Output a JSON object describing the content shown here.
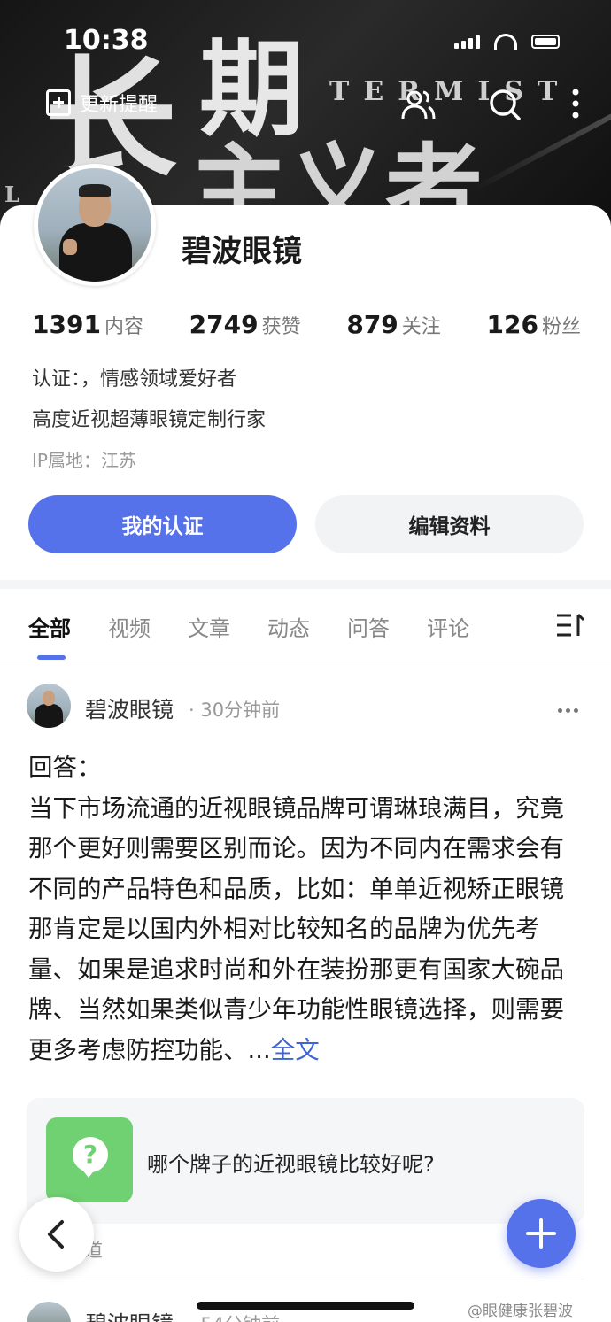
{
  "status_bar": {
    "time": "10:38"
  },
  "banner": {
    "chars": [
      "长",
      "期",
      "主义者"
    ],
    "english": "TERMIST",
    "english_left": "L"
  },
  "top_bar": {
    "update_label": "更新提醒",
    "icons": [
      "users-icon",
      "search-icon",
      "more-icon"
    ]
  },
  "profile": {
    "name": "碧波眼镜",
    "stats": [
      {
        "num": "1391",
        "label": "内容"
      },
      {
        "num": "2749",
        "label": "获赞"
      },
      {
        "num": "879",
        "label": "关注"
      },
      {
        "num": "126",
        "label": "粉丝"
      }
    ],
    "bio_line1": "认证：，情感领域爱好者",
    "bio_line2": "高度近视超薄眼镜定制行家",
    "ip": "IP属地：江苏",
    "btn_primary": "我的认证",
    "btn_secondary": "编辑资料"
  },
  "tabs": {
    "items": [
      "全部",
      "视频",
      "文章",
      "动态",
      "问答",
      "评论"
    ],
    "active": 0,
    "menu_glyph": "三|"
  },
  "post": {
    "author": "碧波眼镜",
    "time": "· 30分钟前",
    "body": "回答：\n当下市场流通的近视眼镜品牌可谓琳琅满目，究竟那个更好则需要区别而论。因为不同内在需求会有不同的产品特色和品质，比如：单单近视矫正眼镜那肯定是以国内外相对比较知名的品牌为优先考量、如果是追求时尚和外在装扮那更有国家大碗品牌、当然如果类似青少年功能性眼镜选择，则需要更多考虑防控功能、...",
    "more_link": "全文",
    "question": "哪个牌子的近视眼镜比较好呢?",
    "question_glyph": "?",
    "source": "百度知道"
  },
  "post2": {
    "author": "碧波眼镜",
    "time": "· 54分钟前"
  },
  "watermark": "@眼健康张碧波",
  "colors": {
    "accent": "#5672ea",
    "question_green": "#6fd172",
    "link": "#3f63d6"
  }
}
